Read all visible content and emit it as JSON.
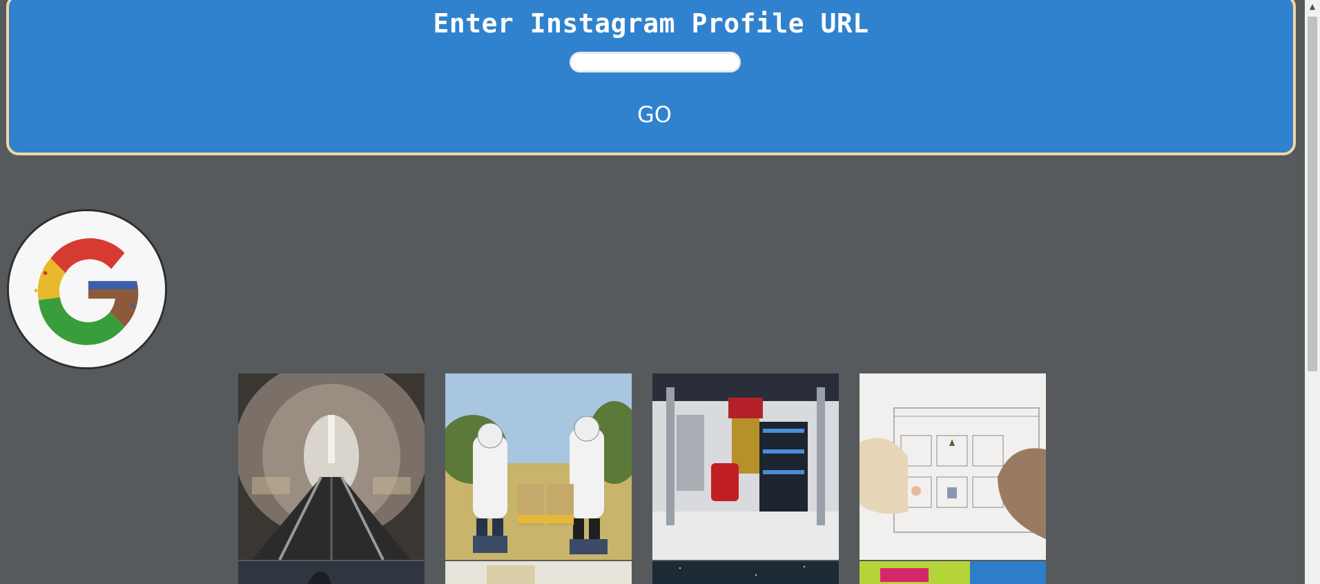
{
  "header": {
    "title": "Enter Instagram Profile URL",
    "url_value": "",
    "go_label": "GO"
  },
  "profile": {
    "avatar_icon": "google-logo-icon"
  },
  "posts": [
    {
      "name": "post-escalator-tunnel"
    },
    {
      "name": "post-beekeepers"
    },
    {
      "name": "post-quantum-lab"
    },
    {
      "name": "post-illustration-tiles"
    },
    {
      "name": "post-dark-sky"
    },
    {
      "name": "post-paper"
    },
    {
      "name": "post-night-sky"
    },
    {
      "name": "post-mural"
    }
  ],
  "colors": {
    "background": "#575a5c",
    "header_bg": "#3182ce",
    "header_border": "#f3d6a4"
  }
}
